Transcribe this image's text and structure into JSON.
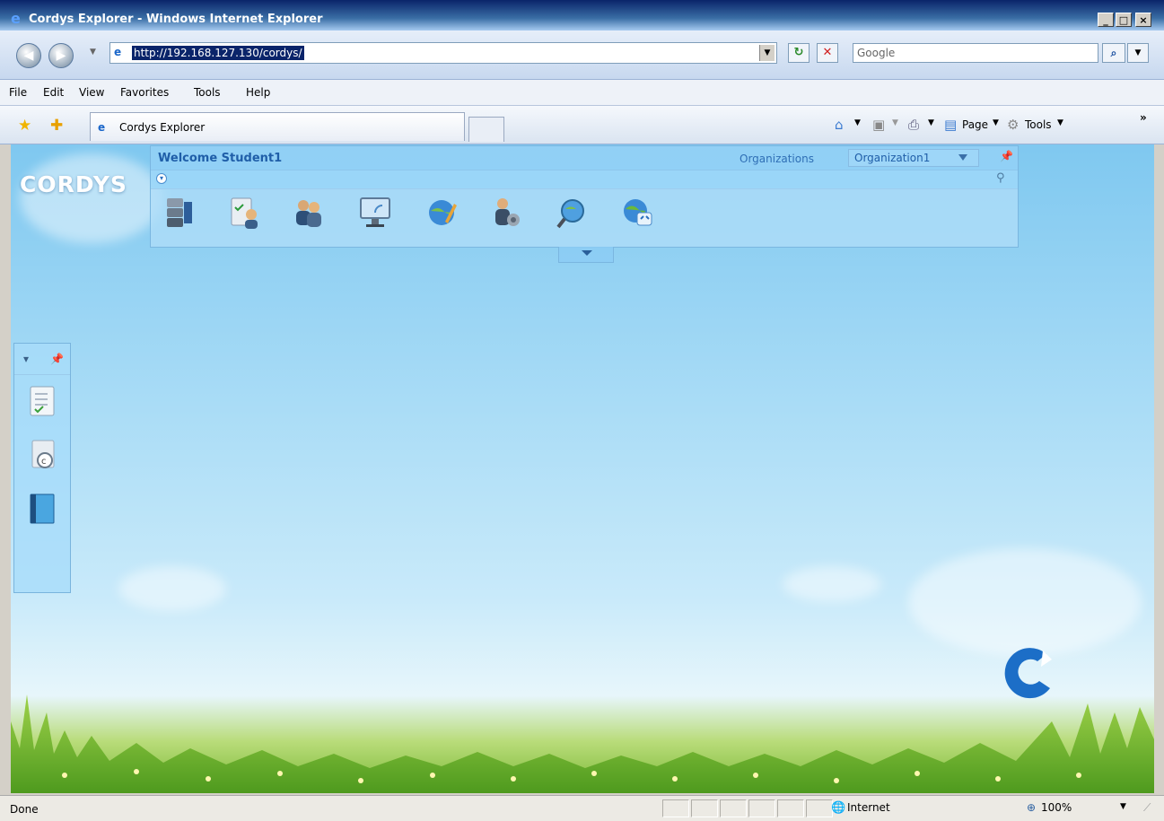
{
  "window": {
    "title": "Cordys Explorer - Windows Internet Explorer",
    "minimize_label": "_",
    "maximize_label": "□",
    "close_label": "×"
  },
  "addressbar": {
    "url": "http://192.168.127.130/cordys/",
    "search_placeholder": "Google"
  },
  "menubar": {
    "items": [
      "File",
      "Edit",
      "View",
      "Favorites",
      "Tools",
      "Help"
    ]
  },
  "favbar": {
    "tab_title": "Cordys Explorer",
    "page_label": "Page",
    "tools_label": "Tools",
    "overflow_label": "»"
  },
  "app": {
    "logo_text": "CORDYS",
    "welcome": "Welcome Student1",
    "organizations_label": "Organizations",
    "organization_value": "Organization1",
    "toolbar_icons": [
      "database-icon",
      "user-tasks-icon",
      "users-icon",
      "monitor-icon",
      "globe-edit-icon",
      "user-settings-icon",
      "search-globe-icon",
      "web-globe-icon"
    ],
    "side_icons": [
      "task-list-icon",
      "copyright-document-icon",
      "book-icon"
    ]
  },
  "statusbar": {
    "status": "Done",
    "zone": "Internet",
    "zoom": "100%"
  },
  "colors": {
    "accent": "#1f5ea8",
    "sky": "#a9dcf6",
    "grass": "#7ab835"
  }
}
